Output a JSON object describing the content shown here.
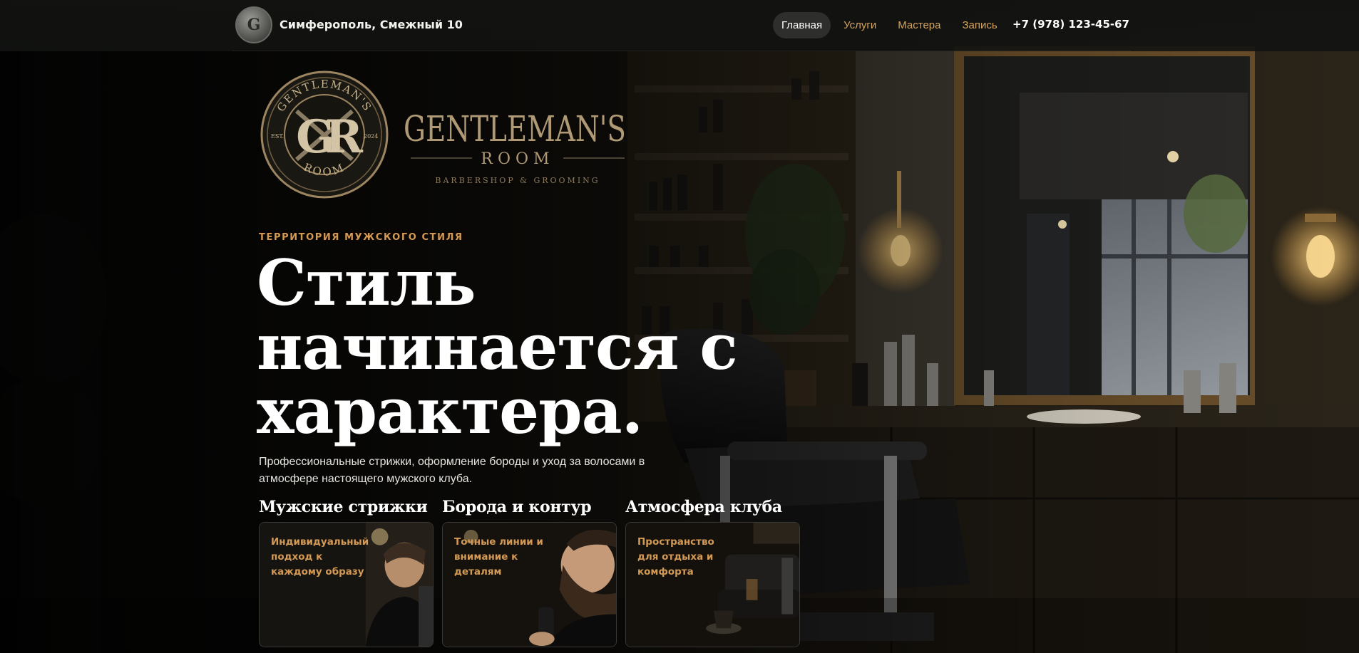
{
  "header": {
    "logo_initials": "G",
    "address": "Симферополь, Смежный 10",
    "nav": [
      {
        "label": "Главная",
        "active": true
      },
      {
        "label": "Услуги",
        "active": false
      },
      {
        "label": "Мастера",
        "active": false
      },
      {
        "label": "Запись",
        "active": false
      }
    ],
    "phone": "+7 (978) 123-45-67"
  },
  "logo": {
    "ring_top": "GENTLEMAN'S",
    "ring_bottom": "ROOM",
    "est": "EST.",
    "year": "2024",
    "monogram": "GR",
    "wordmark": "GENTLEMAN'S",
    "wordmark_sub": "ROOM",
    "tagline": "BARBERSHOP & GROOMING"
  },
  "hero": {
    "eyebrow": "ТЕРРИТОРИЯ МУЖСКОГО СТИЛЯ",
    "headline_line1": "Стиль",
    "headline_line2": "начинается с",
    "headline_line3": "характера.",
    "subtitle": "Профессиональные стрижки, оформление бороды и уход за волосами в атмосфере настоящего мужского клуба."
  },
  "services": [
    {
      "title": "Мужские стрижки",
      "text": "Индивидуальный подход к каждому образу"
    },
    {
      "title": "Борода и контур",
      "text": "Точные линии и внимание к деталям"
    },
    {
      "title": "Атмосфера клуба",
      "text": "Пространство для отдыха и комфорта"
    }
  ],
  "colors": {
    "accent": "#d69a52",
    "background": "#0d0d0c",
    "nav_active_bg": "#2e2f2c"
  }
}
